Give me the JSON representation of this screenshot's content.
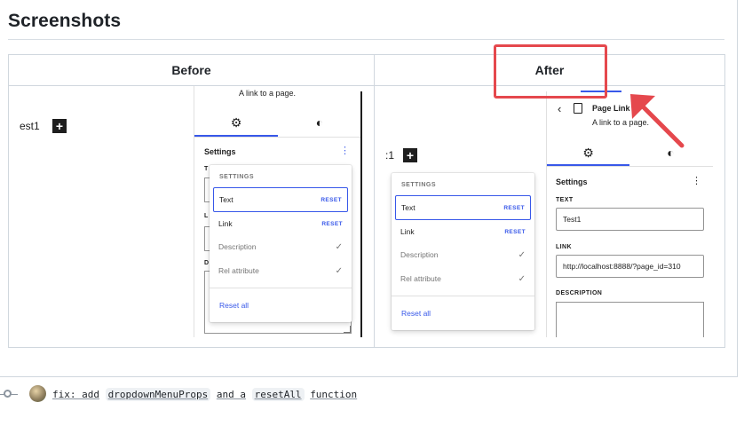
{
  "heading": "Screenshots",
  "table": {
    "col_before": "Before",
    "col_after": "After"
  },
  "before": {
    "canvas_text": "est1",
    "description": "A link to a page.",
    "panel_title": "Settings",
    "left_letters": [
      "T",
      "L",
      "D"
    ],
    "menu": {
      "heading": "SETTINGS",
      "items": [
        {
          "label": "Text",
          "action": "RESET"
        },
        {
          "label": "Link",
          "action": "RESET"
        },
        {
          "label": "Description"
        },
        {
          "label": "Rel attribute"
        }
      ],
      "reset_all": "Reset all"
    }
  },
  "after": {
    "canvas_text": ":1",
    "block_title": "Page Link",
    "description": "A link to a page.",
    "panel_title": "Settings",
    "fields": {
      "text_label": "TEXT",
      "text_value": "Test1",
      "link_label": "LINK",
      "link_value": "http://localhost:8888/?page_id=310",
      "description_label": "DESCRIPTION"
    },
    "menu": {
      "heading": "SETTINGS",
      "items": [
        {
          "label": "Text",
          "action": "RESET"
        },
        {
          "label": "Link",
          "action": "RESET"
        },
        {
          "label": "Description"
        },
        {
          "label": "Rel attribute"
        }
      ],
      "reset_all": "Reset all"
    }
  },
  "icons": {
    "plus": "+",
    "gear": "⚙",
    "contrast": "◐",
    "back": "‹",
    "page": "page-icon",
    "kebab": "⋮",
    "check": "✓"
  },
  "commit": {
    "prefix": "fix: add",
    "code1": "dropdownMenuProps",
    "middle": "and a",
    "code2": "resetAll",
    "suffix": "function"
  },
  "colors": {
    "accent": "#3858e9",
    "annotation": "#e5484d",
    "border": "#d0d7de"
  }
}
